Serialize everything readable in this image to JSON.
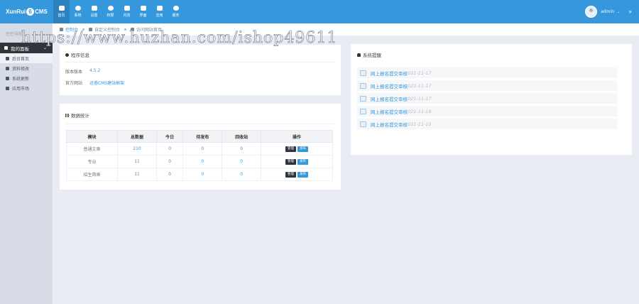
{
  "header": {
    "logo_left": "XunRui",
    "logo_six": "6",
    "logo_right": "CMS",
    "nav": [
      {
        "label": "首页",
        "icon": "home-icon",
        "active": true
      },
      {
        "label": "系统",
        "icon": "globe-icon",
        "active": false
      },
      {
        "label": "设置",
        "icon": "cogs-icon",
        "active": false
      },
      {
        "label": "权限",
        "icon": "user-circle-icon",
        "active": false
      },
      {
        "label": "内容",
        "icon": "grid-icon",
        "active": false
      },
      {
        "label": "界面",
        "icon": "html5-icon",
        "active": false
      },
      {
        "label": "应用",
        "icon": "puzzle-icon",
        "active": false
      },
      {
        "label": "服务",
        "icon": "cloud-icon",
        "active": false
      }
    ],
    "user": {
      "name": "admin",
      "caret": "⌄",
      "more": "»"
    }
  },
  "sidebar": {
    "head": "控控导航",
    "menu_title": "我的面板",
    "chevron": "⌄",
    "items": [
      {
        "label": "后台首页",
        "icon": "home-icon",
        "active": true
      },
      {
        "label": "资料修改",
        "icon": "user-icon",
        "active": false
      },
      {
        "label": "系统更新",
        "icon": "refresh-icon",
        "active": false
      },
      {
        "label": "应用市场",
        "icon": "puzzle-icon",
        "active": false
      }
    ]
  },
  "breadcrumb": {
    "items": [
      {
        "label": "控制台",
        "icon": "home-icon"
      },
      {
        "label": "自定义控制台",
        "icon": "edit-icon"
      },
      {
        "label": "访问网站首页",
        "icon": "send-icon"
      }
    ]
  },
  "watermark": "https://www.huzhan.com/ishop49611",
  "info_panel": {
    "title": "程序信息",
    "rows": [
      {
        "label": "版本版本",
        "value": "4.5.2"
      },
      {
        "label": "官方网站",
        "value": "迅睿CMS建站框架"
      }
    ]
  },
  "stats_panel": {
    "title": "数据统计",
    "columns": [
      "模块",
      "总数据",
      "今日",
      "待发布",
      "回收站",
      "操作"
    ],
    "rows": [
      {
        "module": "普通文章",
        "total": "210",
        "today": "0",
        "pending": "0",
        "recycle": "0"
      },
      {
        "module": "专业",
        "total": "11",
        "today": "0",
        "pending": "0",
        "recycle": "0"
      },
      {
        "module": "招生简章",
        "total": "11",
        "today": "0",
        "pending": "0",
        "recycle": "0"
      }
    ],
    "manage_label": "管理",
    "publish_label": "发布"
  },
  "notice_panel": {
    "title": "系统提醒",
    "items": [
      {
        "text": "网上报名提交审核",
        "date": "021-11-17"
      },
      {
        "text": "网上报名提交审核",
        "date": "021-11-17"
      },
      {
        "text": "网上报名提交审核",
        "date": "021-11-17"
      },
      {
        "text": "网上报名提交审核",
        "date": "021-11-16"
      },
      {
        "text": "网上报名提交审核",
        "date": "021-11-15"
      }
    ]
  },
  "colors": {
    "primary": "#3598dc",
    "dark": "#2f353b",
    "sidebar": "#d8dce6",
    "background": "#e9ecf3"
  }
}
